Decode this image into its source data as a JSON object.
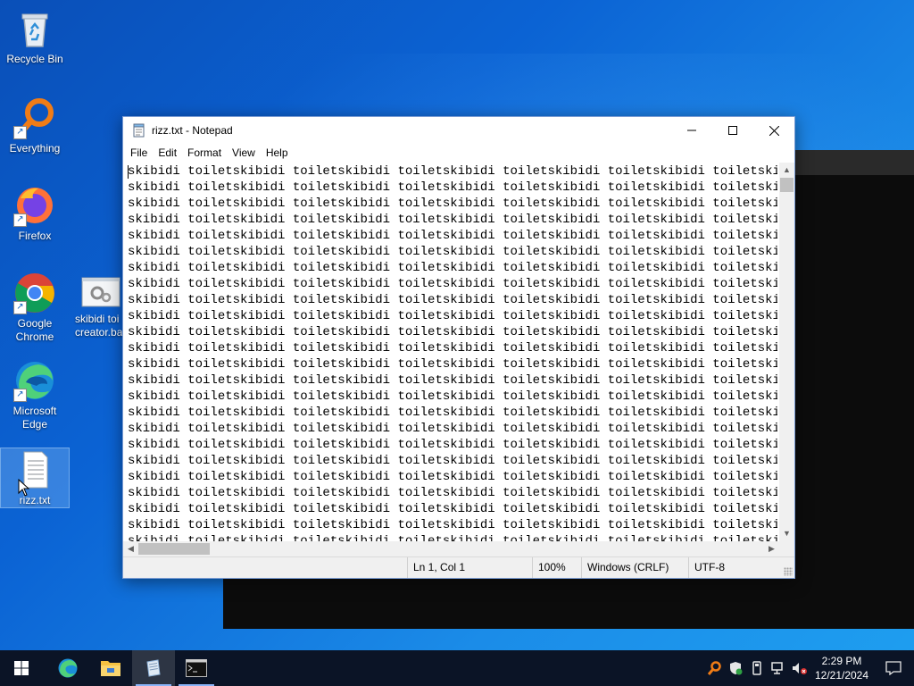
{
  "desktop": {
    "icons": [
      {
        "label": "Recycle Bin"
      },
      {
        "label": "Everything"
      },
      {
        "label": "Firefox"
      },
      {
        "label": "Google Chrome"
      },
      {
        "label": "skibidi toi\ncreator.ba"
      },
      {
        "label": "Microsoft Edge"
      },
      {
        "label": "rizz.txt"
      }
    ]
  },
  "notepad": {
    "title": "rizz.txt - Notepad",
    "menu": [
      "File",
      "Edit",
      "Format",
      "View",
      "Help"
    ],
    "content_line": "skibidi toiletskibidi toiletskibidi toiletskibidi toiletskibidi toiletskibidi toiletskibidi",
    "visible_lines": 24,
    "status": {
      "position": "Ln 1, Col 1",
      "zoom": "100%",
      "line_ending": "Windows (CRLF)",
      "encoding": "UTF-8"
    }
  },
  "taskbar": {
    "apps": [
      "start",
      "edge",
      "file-explorer",
      "notepad",
      "terminal"
    ],
    "active_app": "notepad",
    "time": "2:29 PM",
    "date": "12/21/2024"
  },
  "colors": {
    "taskbar": "#0b1426",
    "desktop_blue": "#0b63d4",
    "accent": "#8ab4f8"
  }
}
